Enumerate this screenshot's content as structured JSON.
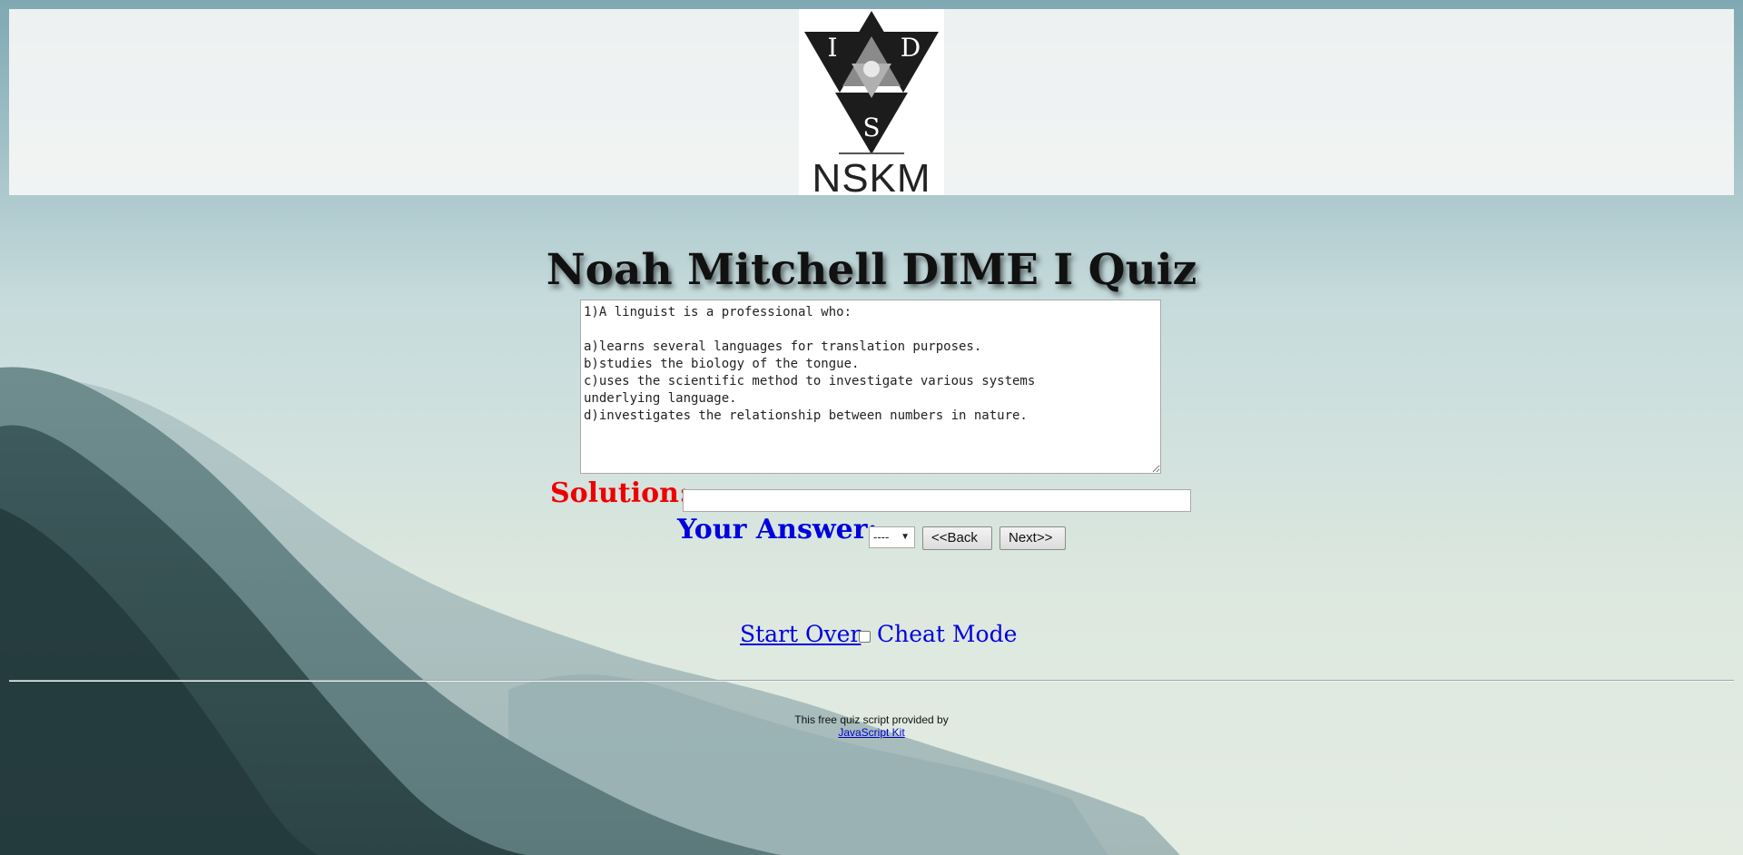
{
  "logo": {
    "letters": [
      "I",
      "D",
      "S"
    ],
    "caption": "NSKM"
  },
  "title": "Noah Mitchell DIME I Quiz",
  "question": {
    "text": "1)A linguist is a professional who:\n\na)learns several languages for translation purposes.\nb)studies the biology of the tongue.\nc)uses the scientific method to investigate various systems\nunderlying language.\nd)investigates the relationship between numbers in nature."
  },
  "solution": {
    "label": "Solution:",
    "value": ""
  },
  "answer": {
    "label": "Your Answer:",
    "selected": "----"
  },
  "buttons": {
    "back": "<<Back",
    "next": "Next>>"
  },
  "controls": {
    "start_over": "Start Over",
    "cheat_mode": "Cheat Mode",
    "cheat_checked": false
  },
  "footer": {
    "credit": "This free quiz script provided by",
    "link": "JavaScript Kit"
  },
  "colors": {
    "solution_label": "#ee0000",
    "answer_label": "#0000dd",
    "link": "#0000cc"
  }
}
